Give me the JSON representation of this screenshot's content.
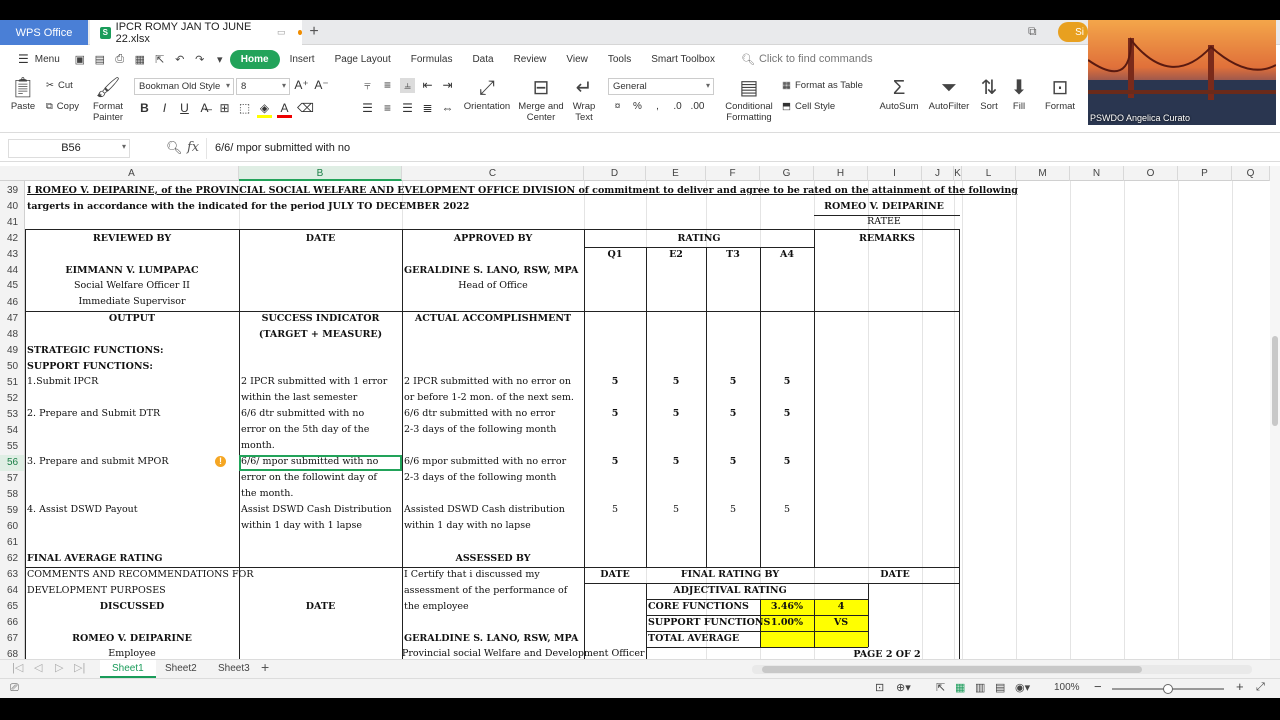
{
  "titlebar": {
    "app": "WPS Office",
    "file": "IPCR ROMY JAN TO JUNE 22.xlsx",
    "avatar": "Si"
  },
  "menu": {
    "menu_label": "Menu",
    "tabs": [
      "Home",
      "Insert",
      "Page Layout",
      "Formulas",
      "Data",
      "Review",
      "View",
      "Tools",
      "Smart Toolbox"
    ],
    "find": "Click to find commands"
  },
  "ribbon": {
    "paste": "Paste",
    "cut": "Cut",
    "copy": "Copy",
    "format_painter": "Format\nPainter",
    "font": "Bookman Old Style",
    "size": "8",
    "orientation": "Orientation",
    "merge": "Merge and Center",
    "wrap": "Wrap Text",
    "number_format": "General",
    "cond_fmt": "Conditional Formatting",
    "fmt_table": "Format as Table",
    "cell_style": "Cell Style",
    "autosum": "AutoSum",
    "autofilter": "AutoFilter",
    "sort": "Sort",
    "fill": "Fill",
    "format": "Format"
  },
  "formula_bar": {
    "cell_ref": "B56",
    "fx": "fx",
    "content": "6/6/ mpor submitted with no"
  },
  "columns": [
    "A",
    "B",
    "C",
    "D",
    "E",
    "F",
    "G",
    "H",
    "I",
    "J",
    "K",
    "L",
    "M",
    "N",
    "O",
    "P",
    "Q"
  ],
  "rows": [
    "39",
    "40",
    "41",
    "42",
    "43",
    "44",
    "45",
    "46",
    "47",
    "48",
    "49",
    "50",
    "51",
    "52",
    "53",
    "54",
    "55",
    "56",
    "57",
    "58",
    "59",
    "60",
    "61",
    "62",
    "63",
    "64",
    "65",
    "66",
    "67",
    "68"
  ],
  "cells": {
    "r39": "I ROMEO V. DEIPARINE, of the PROVINCIAL SOCIAL WELFARE AND EVELOPMENT OFFICE DIVISION of commitment to deliver and agree to be rated on the attainment of the following",
    "r40a": "targerts in accordance with the indicated for the period JULY TO DECEMBER 2022",
    "r40h": "ROMEO V. DEIPARINE",
    "r41h": "RATEE",
    "reviewed_by": "REVIEWED BY",
    "date": "DATE",
    "approved_by": "APPROVED BY",
    "rating": "RATING",
    "remarks": "REMARKS",
    "q1": "Q1",
    "e2": "E2",
    "t3": "T3",
    "a4": "A4",
    "r44a": "EIMMANN V. LUMPAPAC",
    "r44c": "GERALDINE S. LANO, RSW, MPA",
    "r45a": "Social Welfare Officer II",
    "r45c": "Head of Office",
    "r46a": "Immediate Supervisor",
    "output": "OUTPUT",
    "success_ind": "SUCCESS INDICATOR",
    "actual": "ACTUAL ACCOMPLISHMENT",
    "target_measure": "(TARGET + MEASURE)",
    "strategic": "STRATEGIC FUNCTIONS:",
    "support": "SUPPORT FUNCTIONS:",
    "r51a": " 1.Submit IPCR",
    "r51b": "2 IPCR submitted with 1 error",
    "r51c": "2 IPCR submitted with no error on",
    "r52b": "within the last semester",
    "r52c": "or before 1-2 mon. of the next sem.",
    "r53a": "2. Prepare and Submit DTR",
    "r53b": "6/6 dtr submitted with no",
    "r53c": "6/6 dtr submitted with no error",
    "r54b": "error on the 5th day of the",
    "r54c": "2-3 days of the following month",
    "r55b": "month.",
    "r56a": "3. Prepare and submit MPOR",
    "r56b": "6/6/ mpor submitted with no",
    "r56c": "6/6 mpor submitted with no error",
    "r57b": "error on the followint day of",
    "r57c": "2-3 days of the following month",
    "r58b": "the month.",
    "r59a": "4. Assist DSWD Payout",
    "r59b": "Assist DSWD Cash Distribution",
    "r59c": "Assisted DSWD Cash distribution",
    "r60b": "within 1 day with 1 lapse",
    "r60c": "within 1 day with no lapse",
    "five": "5",
    "r62a": "FINAL AVERAGE RATING",
    "r62c": "ASSESSED BY",
    "r63a": "COMMENTS AND RECOMMENDATIONS FOR",
    "r63c": "I Certify that i discussed my",
    "r63d": "DATE",
    "r63f": "FINAL RATING BY",
    "r63i": "DATE",
    "r64a": "DEVELOPMENT PURPOSES",
    "r64c": "assessment of the performance of",
    "r64f": "ADJECTIVAL RATING",
    "r65a": "DISCUSSED",
    "r65b": "DATE",
    "r65c": "the employee",
    "r65f": "CORE FUNCTIONS",
    "r65g": "3.46%",
    "r65h": "4",
    "r66f": "SUPPORT FUNCTIONS",
    "r66g": "1.00%",
    "r66h": "VS",
    "r67a": "ROMEO V. DEIPARINE",
    "r67c": "GERALDINE S. LANO, RSW, MPA",
    "r67f": "TOTAL AVERAGE",
    "r68a": "Employee",
    "r68c": "Provincial social Welfare and Development Officer",
    "r68h": "PAGE 2 OF 2"
  },
  "sheets": [
    "Sheet1",
    "Sheet2",
    "Sheet3"
  ],
  "status": {
    "zoom": "100%"
  },
  "webcam": {
    "label": "PSWDO Angelica Curato"
  },
  "colors": {
    "accent": "#22a35a",
    "highlight": "#ffff00",
    "wps_blue": "#4a7fd6"
  }
}
